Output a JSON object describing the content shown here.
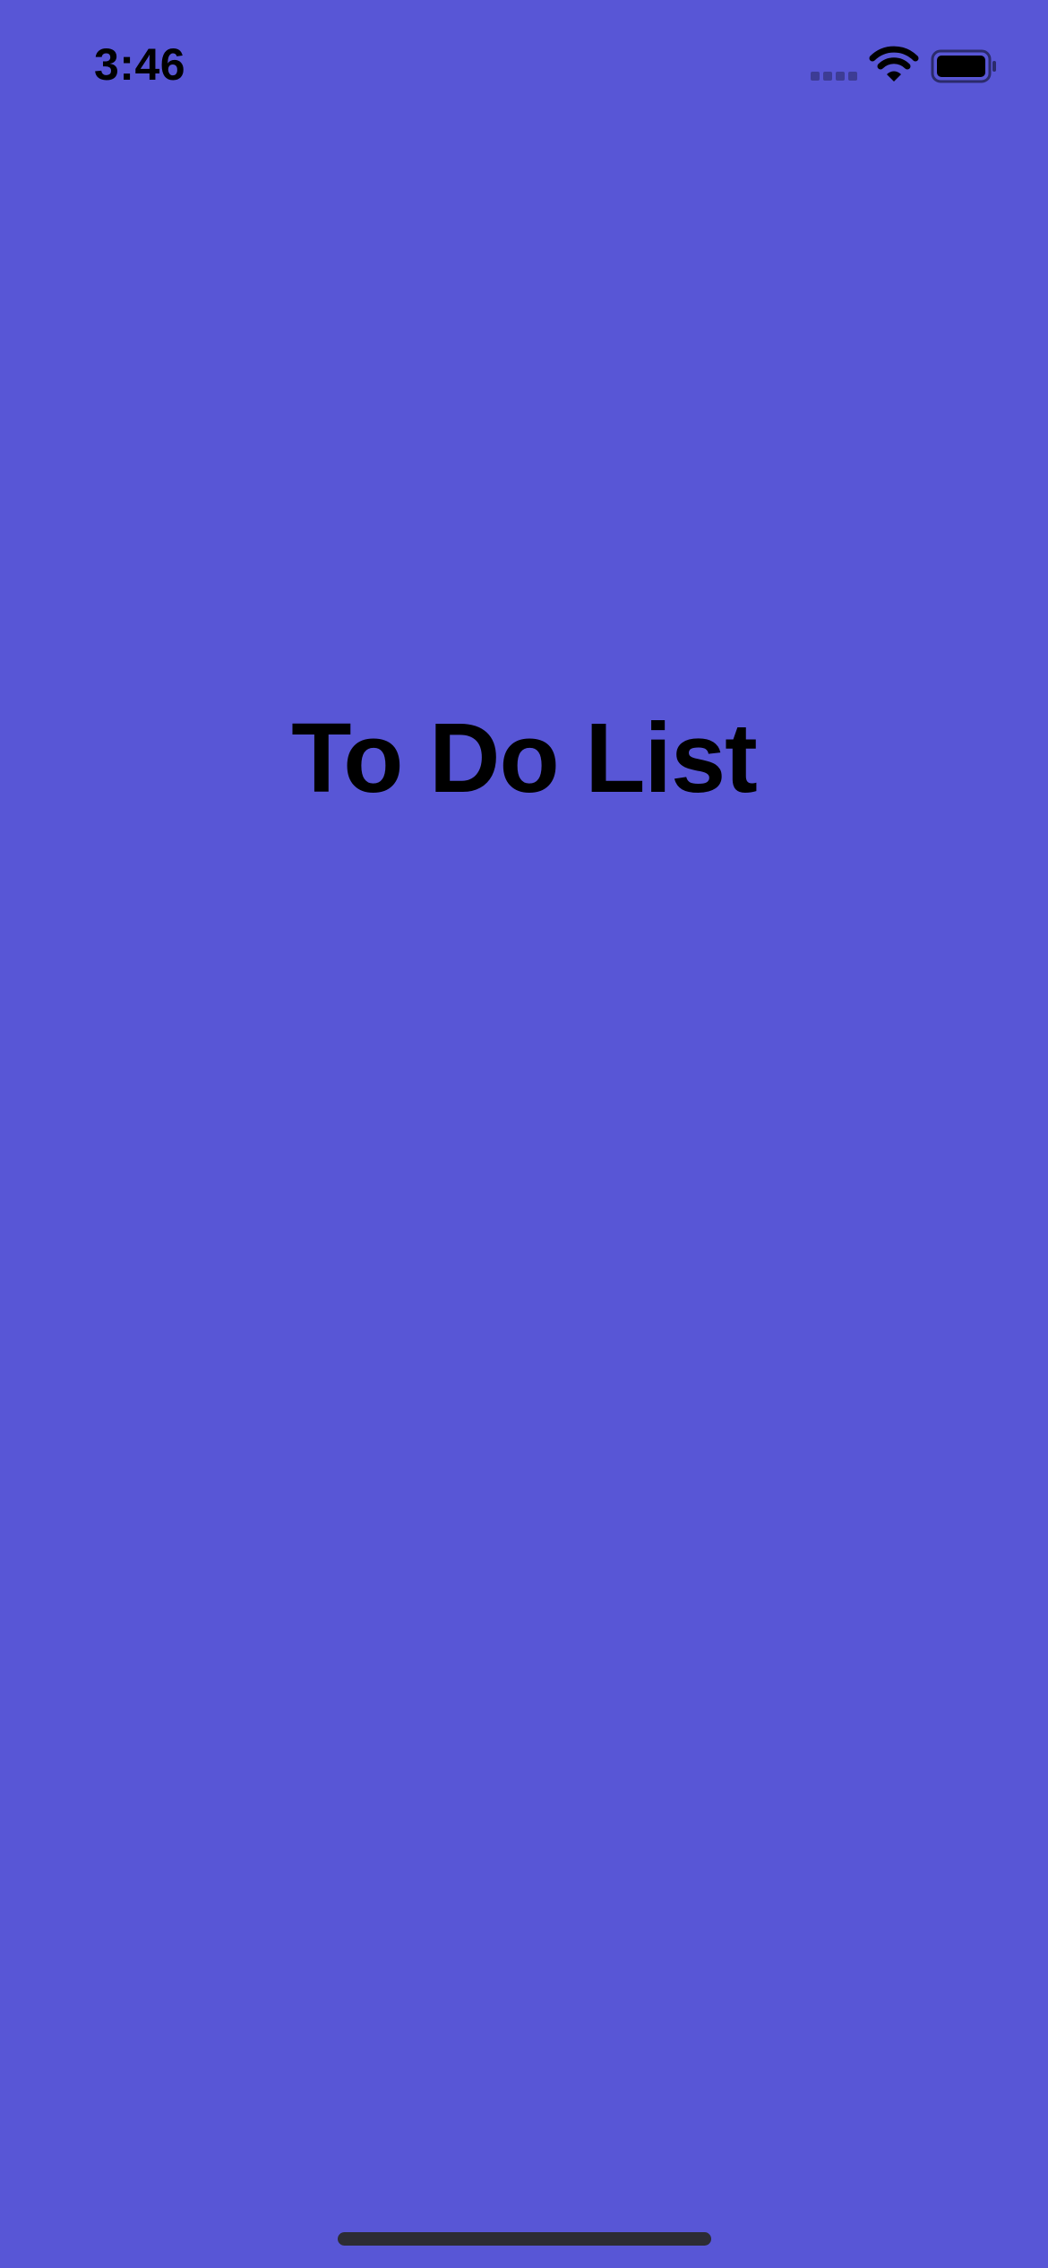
{
  "status_bar": {
    "time": "3:46"
  },
  "main": {
    "title": "To Do List"
  },
  "colors": {
    "background": "#5856D6",
    "text": "#000000"
  },
  "icons": {
    "signal": "cellular-signal-icon",
    "wifi": "wifi-icon",
    "battery": "battery-icon"
  }
}
